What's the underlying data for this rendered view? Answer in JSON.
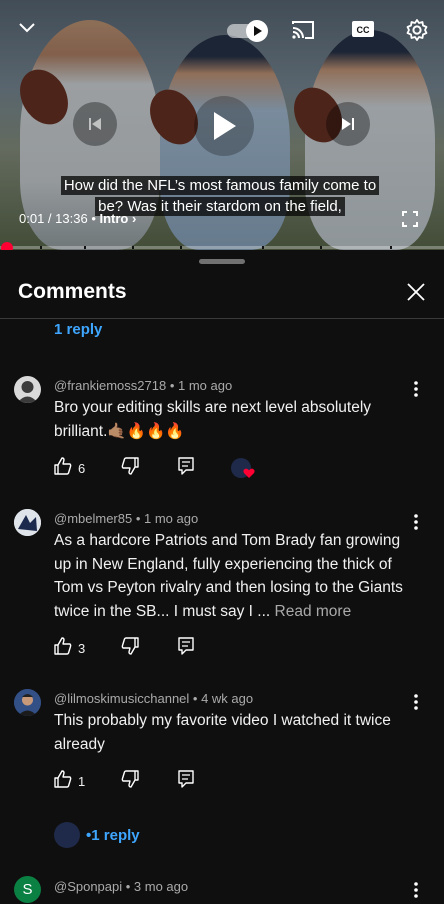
{
  "player": {
    "caption": "How did the NFL’s most famous family come to be? Was it their stardom on the field,",
    "time_current": "0:01",
    "time_sep": " / ",
    "time_total": "13:36",
    "chapter_sep": " • ",
    "chapter": "Intro",
    "progress_fraction": 0.001
  },
  "panel": {
    "title": "Comments"
  },
  "top_reply": "1 reply",
  "comments": [
    {
      "author": "@frankiemoss2718",
      "age": "1 mo ago",
      "text": "Bro your editing skills are next level absolutely brilliant.🤙🏽🔥🔥🔥",
      "likes": "6",
      "creator_heart": true
    },
    {
      "author": "@mbelmer85",
      "age": "1 mo ago",
      "text": "As a hardcore Patriots and Tom Brady fan growing up in New England, fully experiencing the thick of Tom vs Peyton rivalry and then losing to the Giants twice in the SB... I must say I ...",
      "read_more": "Read more",
      "likes": "3"
    },
    {
      "author": "@lilmoskimusicchannel",
      "age": "4 wk ago",
      "text": "This probably my favorite video I watched it twice already",
      "likes": "1",
      "replies": "1 reply"
    },
    {
      "author": "@Sponpapi",
      "age": "3 mo ago",
      "avatar_letter": "S"
    }
  ],
  "meta_sep": " • ",
  "colors": {
    "background": "#0f0f0f",
    "link": "#3ea6ff",
    "progress": "#ff0033",
    "avatar_s": "#0b8043"
  }
}
